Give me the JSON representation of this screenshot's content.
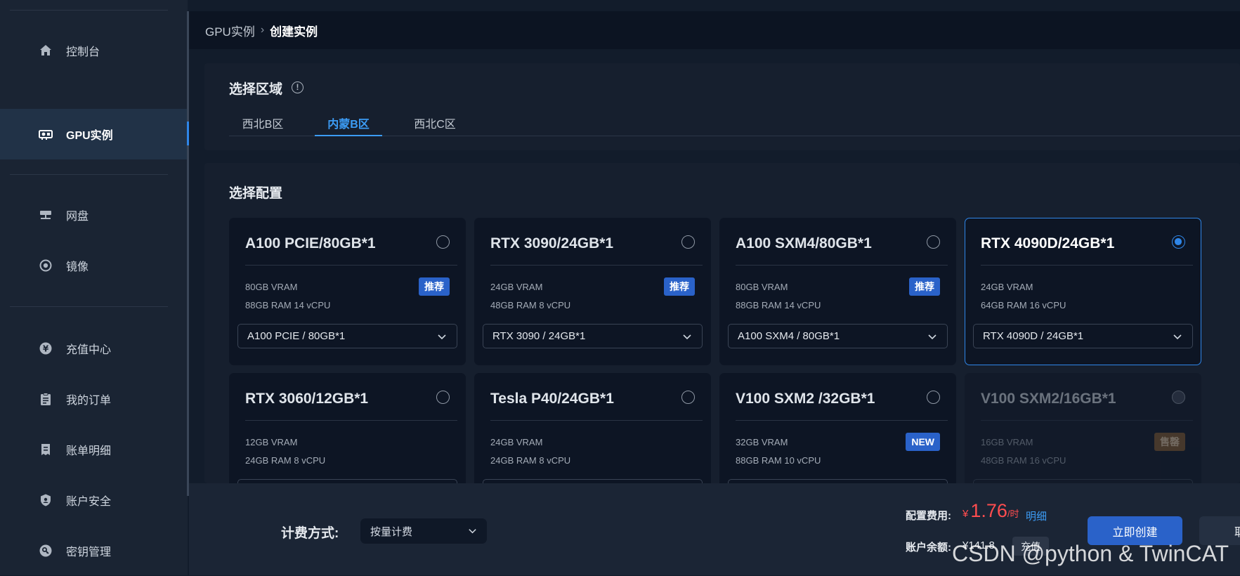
{
  "sidebar": {
    "items": [
      {
        "label": "控制台",
        "icon": "home-icon"
      },
      {
        "label": "GPU实例",
        "icon": "gpu-card-icon",
        "active": true
      },
      {
        "label": "网盘",
        "icon": "network-disk-icon"
      },
      {
        "label": "镜像",
        "icon": "mirror-icon"
      },
      {
        "label": "充值中心",
        "icon": "yen-coin-icon"
      },
      {
        "label": "我的订单",
        "icon": "clipboard-icon"
      },
      {
        "label": "账单明细",
        "icon": "bill-icon"
      },
      {
        "label": "账户安全",
        "icon": "shield-icon"
      },
      {
        "label": "密钥管理",
        "icon": "key-icon"
      }
    ]
  },
  "breadcrumb": {
    "parent": "GPU实例",
    "separator": "›",
    "current": "创建实例"
  },
  "region": {
    "title": "选择区域",
    "tabs": [
      {
        "label": "西北B区"
      },
      {
        "label": "内蒙B区",
        "active": true
      },
      {
        "label": "西北C区"
      }
    ]
  },
  "config": {
    "title": "选择配置",
    "cards": [
      {
        "title": "A100 PCIE/80GB*1",
        "vram": "80GB VRAM",
        "spec": "88GB RAM 14 vCPU",
        "badge": "推荐",
        "select": "A100 PCIE / 80GB*1"
      },
      {
        "title": "RTX 3090/24GB*1",
        "vram": "24GB VRAM",
        "spec": "48GB RAM 8 vCPU",
        "badge": "推荐",
        "select": "RTX 3090 / 24GB*1"
      },
      {
        "title": "A100 SXM4/80GB*1",
        "vram": "80GB VRAM",
        "spec": "88GB RAM 14 vCPU",
        "badge": "推荐",
        "select": "A100 SXM4 / 80GB*1"
      },
      {
        "title": "RTX 4090D/24GB*1",
        "vram": "24GB VRAM",
        "spec": "64GB RAM 16 vCPU",
        "badge": "",
        "select": "RTX 4090D / 24GB*1",
        "selected": true
      },
      {
        "title": "RTX 3060/12GB*1",
        "vram": "12GB VRAM",
        "spec": "24GB RAM 8 vCPU",
        "badge": ""
      },
      {
        "title": "Tesla P40/24GB*1",
        "vram": "24GB VRAM",
        "spec": "24GB RAM 8 vCPU",
        "badge": ""
      },
      {
        "title": "V100 SXM2 /32GB*1",
        "vram": "32GB VRAM",
        "spec": "88GB RAM 10 vCPU",
        "badge": "NEW"
      },
      {
        "title": "V100 SXM2/16GB*1",
        "vram": "16GB VRAM",
        "spec": "48GB RAM 16 vCPU",
        "badge": "售罄",
        "disabled": true
      }
    ]
  },
  "billing": {
    "label": "计费方式:",
    "value": "按量计费",
    "fee_label": "配置费用:",
    "currency": "¥",
    "price": "1.76",
    "unit": "/时",
    "detail_link": "明细",
    "balance_label": "账户余额:",
    "balance_value": "¥141.8",
    "recharge": "充值",
    "create": "立即创建",
    "cancel": "取消"
  },
  "watermark": "CSDN @python & TwinCAT",
  "colors": {
    "accent": "#2f86e8",
    "price": "#ff4d4f",
    "sold_badge": "#8a5b2a"
  }
}
